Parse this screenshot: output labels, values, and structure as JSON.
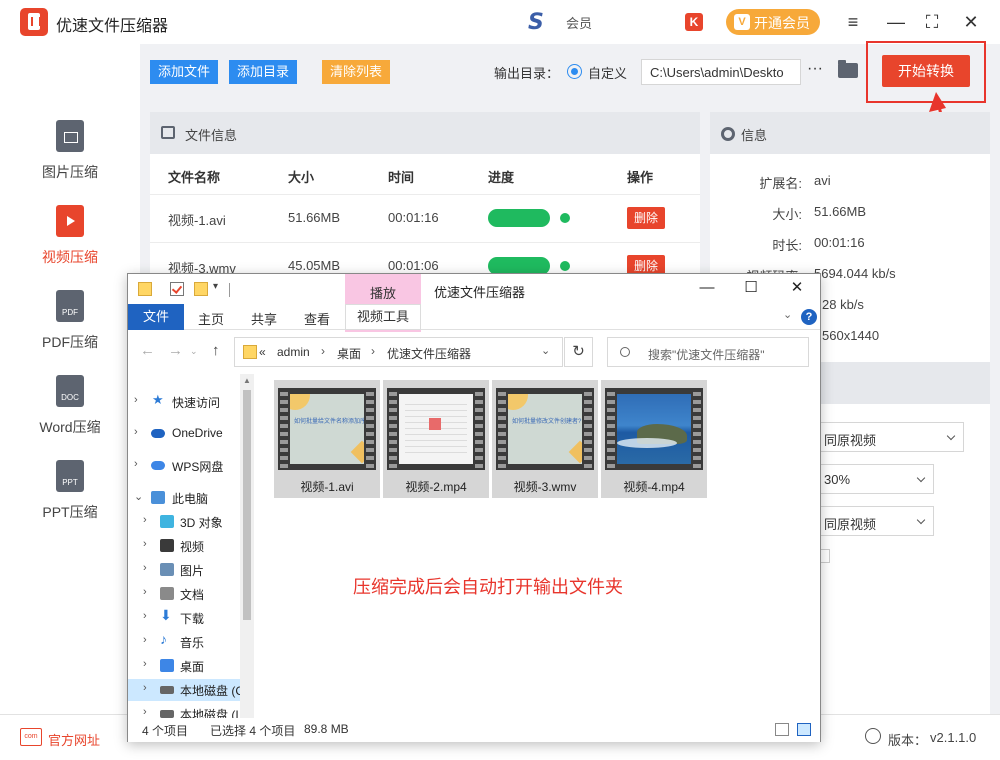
{
  "app": {
    "title": "优速文件压缩器",
    "brand_text": "会员",
    "vip_button": "开通会员",
    "window_controls": [
      "≡",
      "—",
      "⛶",
      "✕"
    ]
  },
  "sidebar": {
    "items": [
      {
        "label": "图片压缩",
        "icon": "image-file-icon",
        "active": false
      },
      {
        "label": "视频压缩",
        "icon": "video-file-icon",
        "active": true
      },
      {
        "label": "PDF压缩",
        "icon": "pdf-file-icon",
        "tag": "PDF",
        "active": false
      },
      {
        "label": "Word压缩",
        "icon": "doc-file-icon",
        "tag": "DOC",
        "active": false
      },
      {
        "label": "PPT压缩",
        "icon": "ppt-file-icon",
        "tag": "PPT",
        "active": false
      }
    ]
  },
  "toolbar": {
    "add_file": "添加文件",
    "add_dir": "添加目录",
    "clear_list": "清除列表",
    "output_label": "输出目录：",
    "custom_label": "自定义",
    "output_path": "C:\\Users\\admin\\Deskto",
    "more": "···",
    "start": "开始转换"
  },
  "file_panel": {
    "title": "文件信息",
    "columns": [
      "文件名称",
      "大小",
      "时间",
      "进度",
      "操作"
    ],
    "rows": [
      {
        "name": "视频-1.avi",
        "size": "51.66MB",
        "time": "00:01:16",
        "progress": 1.0,
        "action": "删除"
      },
      {
        "name": "视频-3.wmv",
        "size": "45.05MB",
        "time": "00:01:06",
        "progress": 1.0,
        "action": "删除"
      }
    ]
  },
  "info_panel": {
    "title": "信息",
    "fields": [
      {
        "key": "扩展名:",
        "value": "avi"
      },
      {
        "key": "大小:",
        "value": "51.66MB"
      },
      {
        "key": "时长:",
        "value": "00:01:16"
      },
      {
        "key": "视频码率:",
        "value": "5694.044 kb/s"
      },
      {
        "key": "",
        "value": "28 kb/s"
      },
      {
        "key": "",
        "value": "560x1440"
      }
    ],
    "selects": [
      "同原视频",
      "30%",
      "同原视频"
    ]
  },
  "bottom": {
    "website": "官方网址",
    "version_label": "版本：",
    "version": "v2.1.1.0"
  },
  "explorer": {
    "title": "优速文件压缩器",
    "play_tab": "播放",
    "ribbon_tabs": [
      "文件",
      "主页",
      "共享",
      "查看"
    ],
    "video_tools": "视频工具",
    "breadcrumb": [
      "«",
      "admin",
      "桌面",
      "优速文件压缩器"
    ],
    "search_placeholder": "搜索\"优速文件压缩器\"",
    "nav": [
      {
        "label": "快速访问",
        "icon": "star-icon",
        "color": "#2d7bd6"
      },
      {
        "label": "OneDrive",
        "icon": "cloud-icon",
        "color": "#1f63c1"
      },
      {
        "label": "WPS网盘",
        "icon": "cloud-icon",
        "color": "#3d86e6"
      },
      {
        "label": "此电脑",
        "icon": "computer-icon",
        "color": "#4a90d9"
      },
      {
        "label": "3D 对象",
        "icon": "cube-icon",
        "color": "#3fb4e0"
      },
      {
        "label": "视频",
        "icon": "film-icon",
        "color": "#3a3a3a"
      },
      {
        "label": "图片",
        "icon": "picture-icon",
        "color": "#6a8fb5"
      },
      {
        "label": "文档",
        "icon": "document-icon",
        "color": "#8a8a8a"
      },
      {
        "label": "下载",
        "icon": "download-icon",
        "color": "#2d7bd6"
      },
      {
        "label": "音乐",
        "icon": "music-icon",
        "color": "#2d7bd6"
      },
      {
        "label": "桌面",
        "icon": "desktop-icon",
        "color": "#3d86e6"
      },
      {
        "label": "本地磁盘 (C",
        "icon": "disk-icon",
        "color": "#666666"
      },
      {
        "label": "本地磁盘 (I",
        "icon": "disk-icon",
        "color": "#666666"
      }
    ],
    "files": [
      {
        "name": "视频-1.avi",
        "frame": "slide",
        "caption": "如何批量给文件名称添加序号"
      },
      {
        "name": "视频-2.mp4",
        "frame": "table",
        "caption": ""
      },
      {
        "name": "视频-3.wmv",
        "frame": "slide",
        "caption": "如何批量修改文件创建者?"
      },
      {
        "name": "视频-4.mp4",
        "frame": "ocean",
        "caption": ""
      }
    ],
    "note": "压缩完成后会自动打开输出文件夹",
    "status": {
      "count": "4 个项目",
      "selected": "已选择 4 个项目",
      "size": "89.8 MB"
    }
  }
}
